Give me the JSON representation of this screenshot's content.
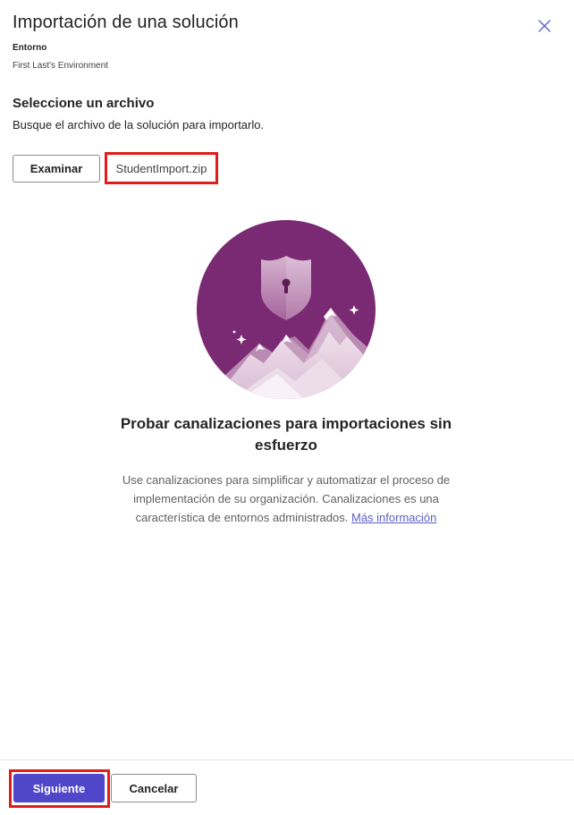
{
  "dialog": {
    "title": "Importación de una solución",
    "environment_label": "Entorno",
    "environment_value": "First Last's Environment"
  },
  "file_section": {
    "title": "Seleccione un archivo",
    "description": "Busque el archivo de la solución para importarlo.",
    "browse_label": "Examinar",
    "selected_file": "StudentImport.zip"
  },
  "promo": {
    "title": "Probar canalizaciones para importaciones sin esfuerzo",
    "description": "Use canalizaciones para simplificar y automatizar el proceso de implementación de su organización. Canalizaciones es una característica de entornos administrados.",
    "link_text": "Más información",
    "illustration": "shield-mountains-illustration"
  },
  "footer": {
    "next_label": "Siguiente",
    "cancel_label": "Cancelar"
  },
  "icons": {
    "close": "close-icon"
  },
  "colors": {
    "accent": "#4f46c9",
    "link": "#5b5fc7",
    "highlight": "#e21b1b",
    "illustration_purple": "#7a2a72"
  }
}
